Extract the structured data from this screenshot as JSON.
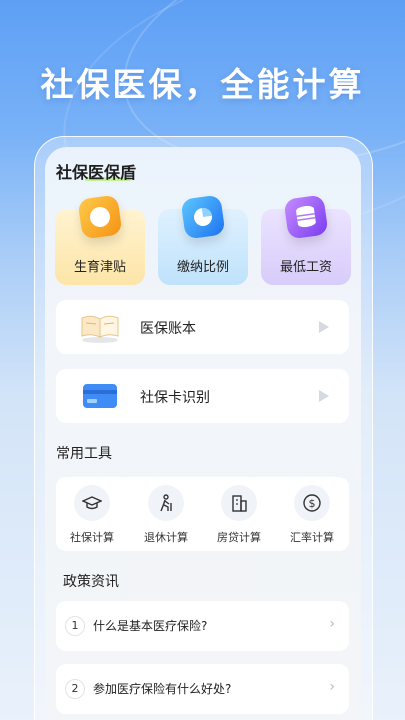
{
  "headline": "社保医保，全能计算",
  "app": {
    "title": "社保医保盾"
  },
  "features": [
    {
      "label": "生育津贴",
      "icon": "baby-bottle-icon"
    },
    {
      "label": "缴纳比例",
      "icon": "pie-chart-icon"
    },
    {
      "label": "最低工资",
      "icon": "coins-stack-icon"
    }
  ],
  "rows": [
    {
      "label": "医保账本",
      "icon": "book-icon"
    },
    {
      "label": "社保卡识别",
      "icon": "card-icon"
    }
  ],
  "tools_section": {
    "title": "常用工具",
    "items": [
      {
        "label": "社保计算",
        "icon": "graduation-cap-icon"
      },
      {
        "label": "退休计算",
        "icon": "walking-elder-icon"
      },
      {
        "label": "房贷计算",
        "icon": "building-icon"
      },
      {
        "label": "汇率计算",
        "icon": "dollar-circle-icon"
      }
    ]
  },
  "news_section": {
    "title": "政策资讯",
    "items": [
      {
        "num": "1",
        "text": "什么是基本医疗保险?"
      },
      {
        "num": "2",
        "text": "参加医疗保险有什么好处?"
      }
    ]
  }
}
